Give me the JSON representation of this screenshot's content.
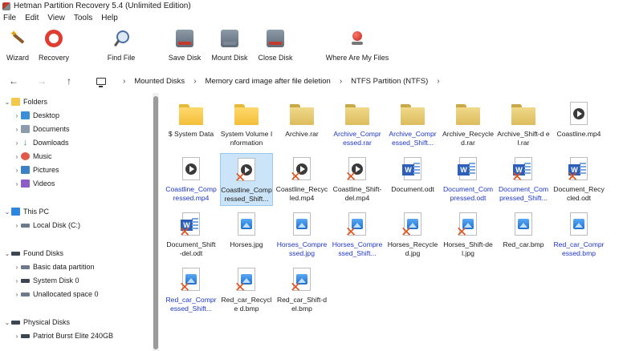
{
  "window": {
    "title": "Hetman Partition Recovery 5.4 (Unlimited Edition)"
  },
  "menu": [
    "File",
    "Edit",
    "View",
    "Tools",
    "Help"
  ],
  "toolbar": [
    {
      "label": "Wizard",
      "icon": "wizard-wand-icon"
    },
    {
      "label": "Recovery",
      "icon": "lifebuoy-icon"
    },
    {
      "label": "Find File",
      "icon": "magnifier-icon"
    },
    {
      "label": "Save Disk",
      "icon": "save-disk-icon"
    },
    {
      "label": "Mount Disk",
      "icon": "mount-disk-icon"
    },
    {
      "label": "Close Disk",
      "icon": "close-disk-icon"
    },
    {
      "label": "Where Are My Files",
      "icon": "red-button-icon"
    }
  ],
  "address": {
    "crumbs": [
      "Mounted Disks",
      "Memory card image after file deletion",
      "NTFS Partition (NTFS)"
    ]
  },
  "sidebar": {
    "folders_label": "Folders",
    "folders": [
      "Desktop",
      "Documents",
      "Downloads",
      "Music",
      "Pictures",
      "Videos"
    ],
    "this_pc_label": "This PC",
    "this_pc": [
      "Local Disk (C:)"
    ],
    "found_disks_label": "Found Disks",
    "found_disks": [
      "Basic data partition",
      "System Disk 0",
      "Unallocated space 0"
    ],
    "physical_disks_label": "Physical Disks",
    "physical_disks": [
      "Patriot Burst Elite 240GB"
    ]
  },
  "files": [
    {
      "name": "$ System Data",
      "kind": "folder",
      "deleted": false
    },
    {
      "name": "System  Volume Information",
      "kind": "folder",
      "deleted": false
    },
    {
      "name": "Archive.rar",
      "kind": "folder-gray",
      "deleted": false
    },
    {
      "name": "Archive_Compr essed.rar",
      "kind": "folder-gray",
      "deleted": false,
      "blue": true
    },
    {
      "name": "Archive_Compr essed_Shift...",
      "kind": "folder-gray",
      "deleted": true,
      "blue": true
    },
    {
      "name": "Archive_Recycle d.rar",
      "kind": "folder-gray",
      "deleted": true
    },
    {
      "name": "Archive_Shift-d el.rar",
      "kind": "folder-gray",
      "deleted": true
    },
    {
      "name": "Coastline.mp4",
      "kind": "video",
      "deleted": false
    },
    {
      "name": "Coastline_Comp ressed.mp4",
      "kind": "video",
      "deleted": false,
      "blue": true
    },
    {
      "name": "Coastline_Comp ressed_Shift...",
      "kind": "video",
      "deleted": true,
      "selected": true
    },
    {
      "name": "Coastline_Recyc led.mp4",
      "kind": "video",
      "deleted": true
    },
    {
      "name": "Coastline_Shift- del.mp4",
      "kind": "video",
      "deleted": true
    },
    {
      "name": "Document.odt",
      "kind": "doc",
      "deleted": false
    },
    {
      "name": "Document_Com pressed.odt",
      "kind": "doc",
      "deleted": false,
      "blue": true
    },
    {
      "name": "Document_Com pressed_Shift...",
      "kind": "doc",
      "deleted": true,
      "blue": true
    },
    {
      "name": "Document_Recy cled.odt",
      "kind": "doc",
      "deleted": true
    },
    {
      "name": "Document_Shift -del.odt",
      "kind": "doc",
      "deleted": true
    },
    {
      "name": "Horses.jpg",
      "kind": "image",
      "deleted": false
    },
    {
      "name": "Horses_Compre ssed.jpg",
      "kind": "image",
      "deleted": false,
      "blue": true
    },
    {
      "name": "Horses_Compre ssed_Shift...",
      "kind": "image",
      "deleted": true,
      "blue": true
    },
    {
      "name": "Horses_Recycle d.jpg",
      "kind": "image",
      "deleted": true
    },
    {
      "name": "Horses_Shift-de l.jpg",
      "kind": "image",
      "deleted": true
    },
    {
      "name": "Red_car.bmp",
      "kind": "image",
      "deleted": false
    },
    {
      "name": "Red_car_Compr essed.bmp",
      "kind": "image",
      "deleted": false,
      "blue": true
    },
    {
      "name": "Red_car_Compr essed_Shift...",
      "kind": "image",
      "deleted": true,
      "blue": true
    },
    {
      "name": "Red_car_Recycle d.bmp",
      "kind": "image",
      "deleted": true
    },
    {
      "name": "Red_car_Shift-d el.bmp",
      "kind": "image",
      "deleted": true
    }
  ]
}
